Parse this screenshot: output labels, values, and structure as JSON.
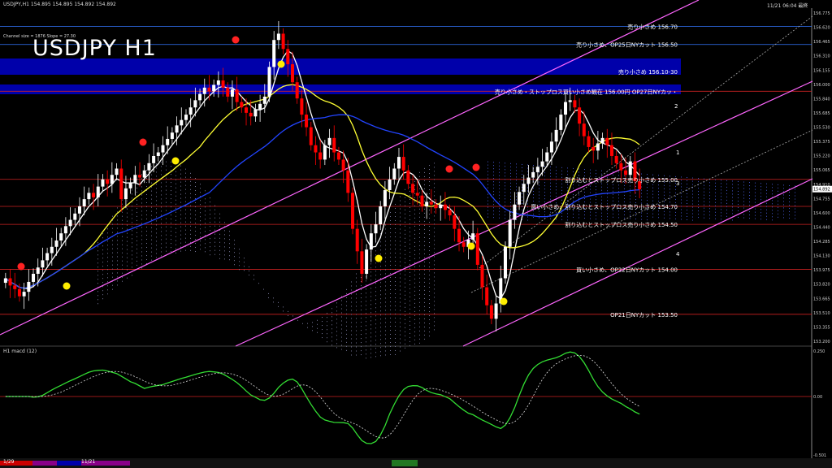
{
  "window": {
    "header_left": "USDJPY,H1  154.895 154.895 154.892 154.892",
    "header_right": "11/21 06:04 最終",
    "channel_info": "Channel size = 1876  Slope = 27.30"
  },
  "chart_title": "USDJPY H1",
  "colors": {
    "background": "#000000",
    "bull_candle": "#ffffff",
    "bear_candle": "#ff0000",
    "channel": "#ff66ff",
    "ma_white": "#ffffff",
    "ma_yellow": "#ffff33",
    "ma_blue": "#2244ff",
    "cloud": "#8888ff",
    "band": "#0000aa",
    "macd_up": "#33dd33",
    "macd_down": "#ff88cc",
    "level_line": "#cc2222",
    "blue_line": "#3377ff"
  },
  "annotations": [
    {
      "text": "売り小さめ 156.70",
      "price": 156.7
    },
    {
      "text": "売り小さめ、OP25日NYカット 156.50",
      "price": 156.5
    },
    {
      "text": "売り小さめ 156.10-30",
      "price": 156.2
    },
    {
      "text": "売り小さめ・ストップロス買い小さめ観在 156.00円 OP27日NYカッ・",
      "price": 155.98
    },
    {
      "text": "割り込むとストップロス売り小さめ 155.00",
      "price": 155.0
    },
    {
      "text": "買い小さめ、割り込むとストップロス売り小さめ 154.70",
      "price": 154.7
    },
    {
      "text": "割り込むとストップロス売り小さめ 154.50",
      "price": 154.5
    },
    {
      "text": "買い小さめ、OP22日NYカット 154.00",
      "price": 154.0
    },
    {
      "text": "OP21日NYカット 153.50",
      "price": 153.5
    }
  ],
  "channel_labels": [
    "1",
    "2",
    "3",
    "4"
  ],
  "price_axis": {
    "ticks": [
      "156.775",
      "156.620",
      "156.465",
      "156.310",
      "156.155",
      "156.000",
      "155.840",
      "155.685",
      "155.530",
      "155.375",
      "155.220",
      "155.065",
      "154.910",
      "154.755",
      "154.600",
      "154.440",
      "154.285",
      "154.130",
      "153.975",
      "153.820",
      "153.665",
      "153.510",
      "153.355",
      "153.200"
    ],
    "current_price": "154.892"
  },
  "macd_panel": {
    "label": "H1  macd (12)",
    "ticks": [
      "0.250",
      "0.00",
      "-0.501"
    ]
  },
  "time_axis": {
    "labels": [
      "1/29",
      "11/21"
    ]
  },
  "chart_data": {
    "type": "line",
    "subtype": "candlestick",
    "title": "USDJPY H1",
    "xlabel": "",
    "ylabel": "",
    "ylim": [
      153.2,
      156.85
    ],
    "close": [
      153.9,
      153.82,
      153.78,
      153.7,
      153.75,
      153.86,
      153.95,
      154.02,
      154.1,
      154.18,
      154.25,
      154.32,
      154.4,
      154.48,
      154.55,
      154.62,
      154.7,
      154.78,
      154.85,
      154.8,
      154.92,
      155.0,
      154.95,
      155.05,
      155.12,
      154.78,
      154.9,
      154.96,
      155.05,
      155.02,
      155.1,
      155.18,
      155.26,
      155.3,
      155.38,
      155.45,
      155.52,
      155.6,
      155.66,
      155.72,
      155.8,
      155.88,
      155.95,
      156.02,
      155.98,
      156.05,
      156.1,
      156.02,
      155.92,
      156.0,
      155.86,
      155.8,
      155.74,
      155.7,
      155.78,
      155.84,
      155.92,
      156.25,
      156.55,
      156.62,
      156.45,
      156.28,
      156.08,
      155.9,
      155.72,
      155.58,
      155.38,
      155.3,
      155.22,
      155.38,
      155.46,
      155.3,
      155.22,
      155.1,
      154.85,
      154.45,
      154.2,
      153.95,
      154.22,
      154.4,
      154.5,
      154.7,
      154.88,
      155.0,
      155.12,
      155.25,
      155.1,
      154.95,
      154.85,
      154.82,
      154.7,
      154.75,
      154.72,
      154.68,
      154.72,
      154.66,
      154.6,
      154.45,
      154.3,
      154.25,
      154.33,
      154.4,
      154.05,
      153.8,
      153.6,
      153.45,
      153.62,
      153.9,
      154.25,
      154.55,
      154.72,
      154.86,
      154.95,
      155.02,
      155.08,
      155.14,
      155.2,
      155.3,
      155.42,
      155.55,
      155.72,
      155.86,
      155.88,
      155.8,
      155.62,
      155.48,
      155.36,
      155.32,
      155.4,
      155.46,
      155.38,
      155.26,
      155.18,
      155.1,
      155.05,
      155.2,
      154.98,
      154.89
    ]
  }
}
